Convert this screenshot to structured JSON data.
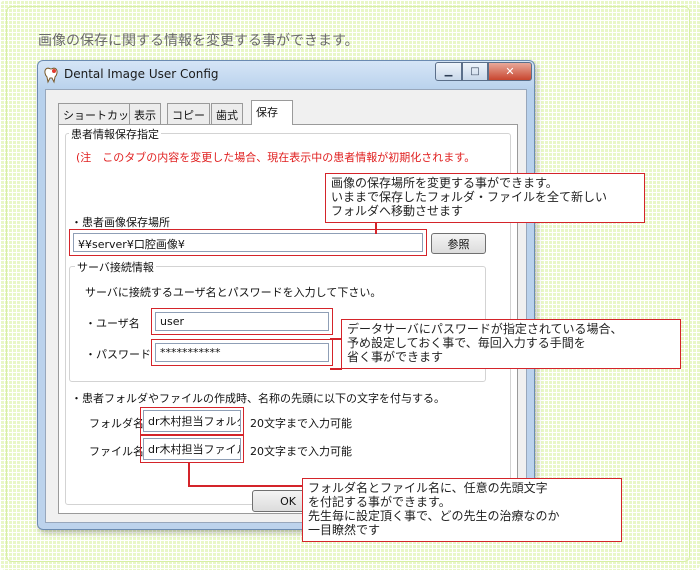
{
  "headline": "画像の保存に関する情報を変更する事ができます。",
  "window": {
    "title": "Dental Image User Config",
    "minimize_glyph": "▁",
    "maximize_glyph": "□",
    "close_glyph": "✕"
  },
  "tabs": [
    {
      "label": "ショートカット",
      "active": false
    },
    {
      "label": "表示",
      "active": false
    },
    {
      "label": "コピー",
      "active": false
    },
    {
      "label": "歯式",
      "active": false
    },
    {
      "label": "保存",
      "active": true
    }
  ],
  "patient_group": {
    "title": "患者情報保存指定",
    "warning": "(注　このタブの内容を変更した場合、現在表示中の患者情報が初期化されます。",
    "image_path_label": "・患者画像保存場所",
    "image_path_value": "¥¥server¥口腔画像¥",
    "browse_label": "参照"
  },
  "server_group": {
    "title": "サーバ接続情報",
    "instruction": "サーバに接続するユーザ名とパスワードを入力して下さい。",
    "username_label": "・ユーザ名",
    "username_value": "user",
    "password_label": "・パスワード",
    "password_value": "***********"
  },
  "prefix_section": {
    "description": "・患者フォルダやファイルの作成時、名称の先頭に以下の文字を付与する。",
    "folder_label": "フォルダ名:",
    "folder_value": "dr木村担当フォルダ",
    "folder_limit": "20文字まで入力可能",
    "file_label": "ファイル名:",
    "file_value": "dr木村担当ファイル",
    "file_limit": "20文字まで入力可能"
  },
  "ok_label": "OK",
  "callouts": {
    "path_note": [
      "画像の保存場所を変更する事ができます。",
      "いままで保存したフォルダ・ファイルを全て新しい",
      "フォルダへ移動させます"
    ],
    "password_note": [
      "データサーバにパスワードが指定されている場合、",
      "予め設定しておく事で、毎回入力する手間を",
      "省く事ができます"
    ],
    "prefix_note": [
      "フォルダ名とファイル名に、任意の先頭文字",
      "を付記する事ができます。",
      "先生毎に設定頂く事で、どの先生の治療なのか",
      "一目瞭然です"
    ]
  },
  "colors": {
    "warning_text": "#e02020",
    "callout_border": "#d4242a",
    "background": "#e9f7c8"
  }
}
